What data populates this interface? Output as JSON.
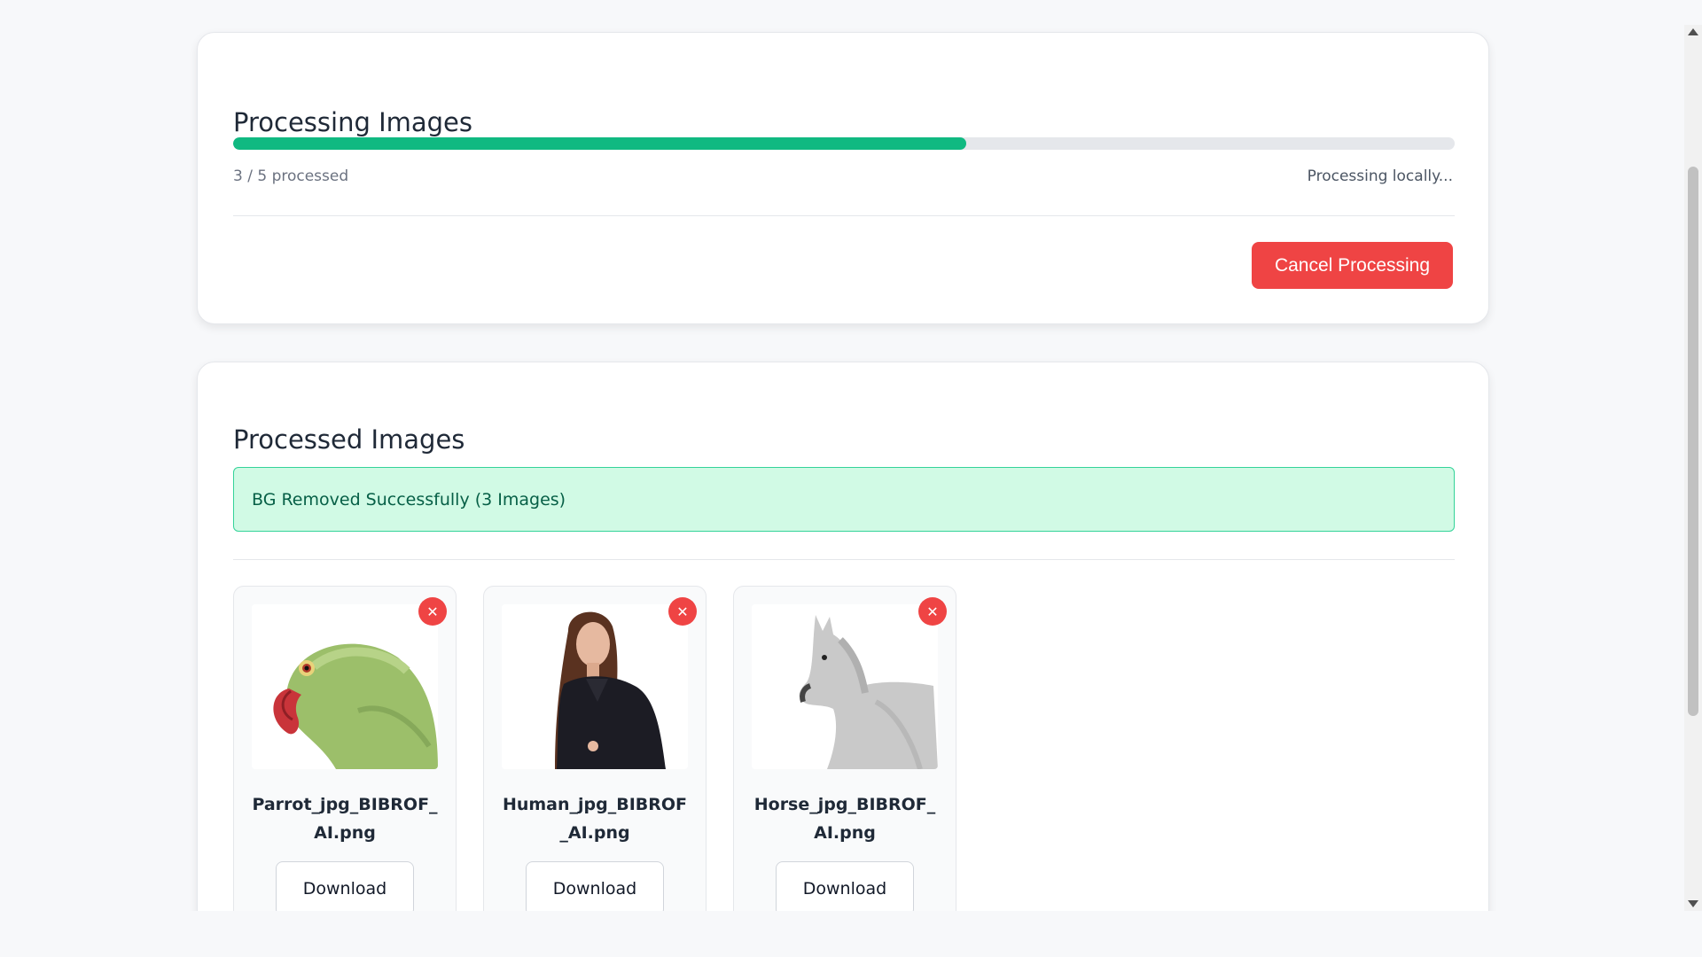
{
  "progress_card": {
    "title": "Processing Images",
    "progress_fraction": 0.6,
    "count_text": "3 / 5 processed",
    "status_text": "Processing locally...",
    "cancel_label": "Cancel Processing",
    "accent_color": "#10b981",
    "danger_color": "#ef4444"
  },
  "results_card": {
    "title": "Processed Images",
    "success_message": "BG Removed Successfully (3 Images)",
    "images": [
      {
        "filename": "Parrot_jpg_BIBROF_AI.png",
        "thumbnail": "parrot",
        "remove_label": "✕",
        "download_label": "Download"
      },
      {
        "filename": "Human_jpg_BIBROF_AI.png",
        "thumbnail": "woman",
        "remove_label": "✕",
        "download_label": "Download"
      },
      {
        "filename": "Horse_jpg_BIBROF_AI.png",
        "thumbnail": "horse",
        "remove_label": "✕",
        "download_label": "Download"
      }
    ]
  }
}
